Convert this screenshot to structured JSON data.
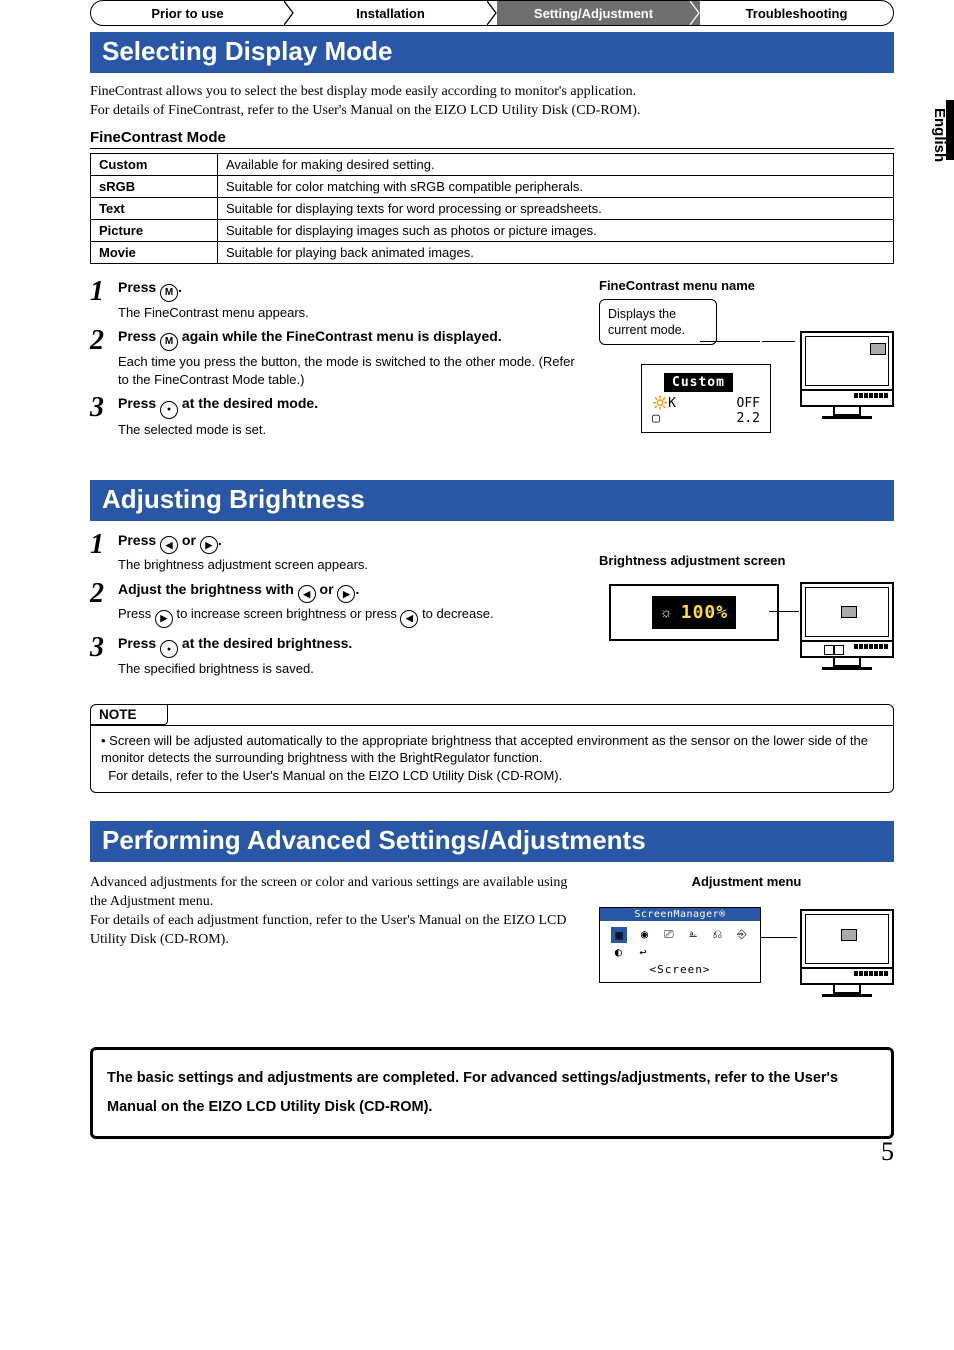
{
  "tabs": {
    "prior": "Prior to use",
    "install": "Installation",
    "setting": "Setting/Adjustment",
    "trouble": "Troubleshooting"
  },
  "lang_tab": "English",
  "page_number": "5",
  "section1": {
    "title": "Selecting Display Mode",
    "lead1": "FineContrast allows you to select the best display mode easily according to monitor's application.",
    "lead2": "For details of FineContrast, refer to the User's Manual on the EIZO LCD Utility Disk (CD-ROM).",
    "table_heading": "FineContrast Mode",
    "modes": [
      {
        "name": "Custom",
        "desc": "Available for making desired setting."
      },
      {
        "name": "sRGB",
        "desc": "Suitable for color matching with sRGB compatible peripherals."
      },
      {
        "name": "Text",
        "desc": "Suitable for displaying texts for word processing or spreadsheets."
      },
      {
        "name": "Picture",
        "desc": "Suitable for displaying images such as photos or picture images."
      },
      {
        "name": "Movie",
        "desc": "Suitable for playing back animated images."
      }
    ],
    "step1": {
      "title_a": "Press ",
      "title_b": ".",
      "desc": "The FineContrast menu appears."
    },
    "step2": {
      "title_a": "Press ",
      "title_b": " again while the FineContrast menu is displayed.",
      "desc": "Each time you press the button, the mode is switched to the other mode. (Refer to the FineContrast Mode table.)"
    },
    "step3": {
      "title_a": "Press ",
      "title_b": " at the desired mode.",
      "desc": "The selected mode is set."
    },
    "figure": {
      "title": "FineContrast menu name",
      "callout": "Displays the current mode.",
      "osd_mode": "Custom",
      "osd_row1_l": "🔆K",
      "osd_row1_r": "OFF",
      "osd_row2_l": "▢",
      "osd_row2_r": "2.2"
    }
  },
  "section2": {
    "title": "Adjusting Brightness",
    "step1": {
      "title_a": "Press ",
      "title_b": " or ",
      "title_c": ".",
      "desc": "The brightness adjustment screen appears."
    },
    "step2": {
      "title_a": "Adjust the brightness with ",
      "title_b": " or ",
      "title_c": ".",
      "desc_a": "Press ",
      "desc_b": " to increase screen brightness or press ",
      "desc_c": " to decrease."
    },
    "step3": {
      "title_a": "Press ",
      "title_b": " at the desired brightness.",
      "desc": "The specified brightness is saved."
    },
    "figure": {
      "title": "Brightness adjustment screen",
      "value": "100%"
    },
    "note_label": "NOTE",
    "note_bullet": "• ",
    "note_body1": "Screen will be adjusted automatically to the appropriate brightness that accepted environment as the sensor on the lower side of the monitor detects the surrounding brightness with the BrightRegulator function.",
    "note_body2": "For details, refer to the User's Manual on the EIZO LCD Utility Disk (CD-ROM)."
  },
  "section3": {
    "title": "Performing Advanced Settings/Adjustments",
    "lead1": "Advanced adjustments for the screen or color and various settings are available using the Adjustment menu.",
    "lead2": "For details of each adjustment function, refer to the User's Manual on the EIZO LCD Utility Disk (CD-ROM).",
    "figure": {
      "title": "Adjustment menu",
      "osd_title": "ScreenManager®",
      "osd_label": "<Screen>"
    }
  },
  "closing": "The basic settings and adjustments are completed. For advanced settings/adjustments, refer to the User's Manual on the EIZO LCD Utility Disk (CD-ROM).",
  "icons": {
    "M": "M",
    "dot": "●",
    "left": "◀",
    "right": "▶"
  }
}
